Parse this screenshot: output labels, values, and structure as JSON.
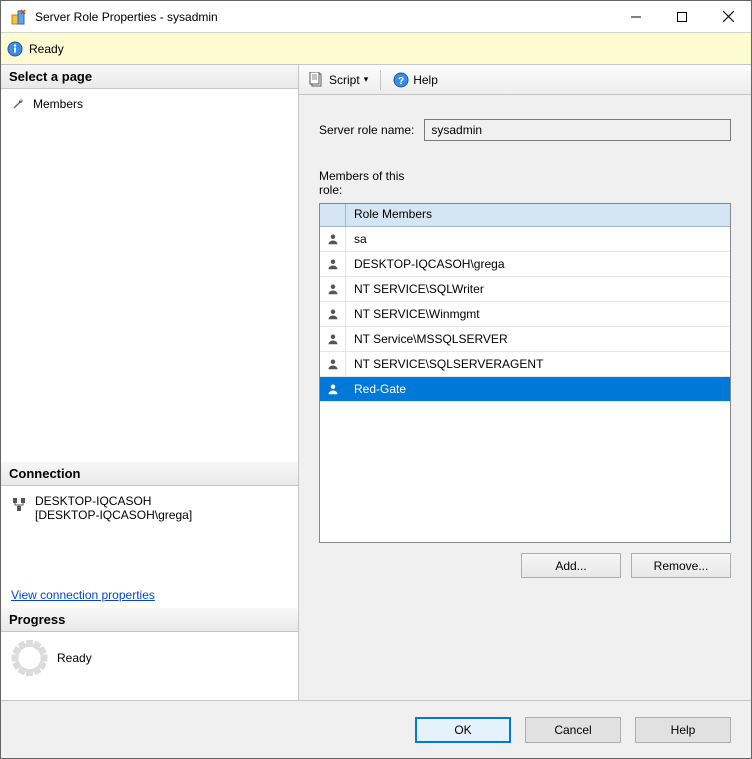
{
  "window": {
    "title": "Server Role Properties - sysadmin"
  },
  "status": {
    "text": "Ready"
  },
  "sidebar": {
    "select_page_header": "Select a page",
    "pages": [
      {
        "label": "Members"
      }
    ],
    "connection_header": "Connection",
    "connection_line1": "DESKTOP-IQCASOH",
    "connection_line2": "[DESKTOP-IQCASOH\\grega]",
    "connection_link": "View connection properties",
    "progress_header": "Progress",
    "progress_text": "Ready"
  },
  "toolbar": {
    "script": "Script",
    "help": "Help"
  },
  "main": {
    "role_name_label": "Server role name:",
    "role_name_value": "sysadmin",
    "members_label": "Members of this role:",
    "column_header": "Role Members",
    "rows": [
      {
        "name": "sa"
      },
      {
        "name": "DESKTOP-IQCASOH\\grega"
      },
      {
        "name": "NT SERVICE\\SQLWriter"
      },
      {
        "name": "NT SERVICE\\Winmgmt"
      },
      {
        "name": "NT Service\\MSSQLSERVER"
      },
      {
        "name": "NT SERVICE\\SQLSERVERAGENT"
      },
      {
        "name": "Red-Gate"
      }
    ],
    "selected_index": 6,
    "add_btn": "Add...",
    "remove_btn": "Remove..."
  },
  "dialog": {
    "ok": "OK",
    "cancel": "Cancel",
    "help": "Help"
  }
}
